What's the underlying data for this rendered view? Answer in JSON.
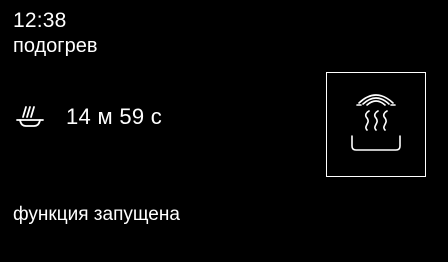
{
  "display": {
    "clock": "12:38",
    "mode_name": "подогрев",
    "timer": {
      "value": "14 м 59 с",
      "icon": "pot-steam-icon"
    },
    "status": "функция запущена",
    "mode_tile": {
      "icon": "plate-warming-icon",
      "selected": true
    }
  },
  "colors": {
    "background": "#000000",
    "foreground": "#ffffff"
  }
}
